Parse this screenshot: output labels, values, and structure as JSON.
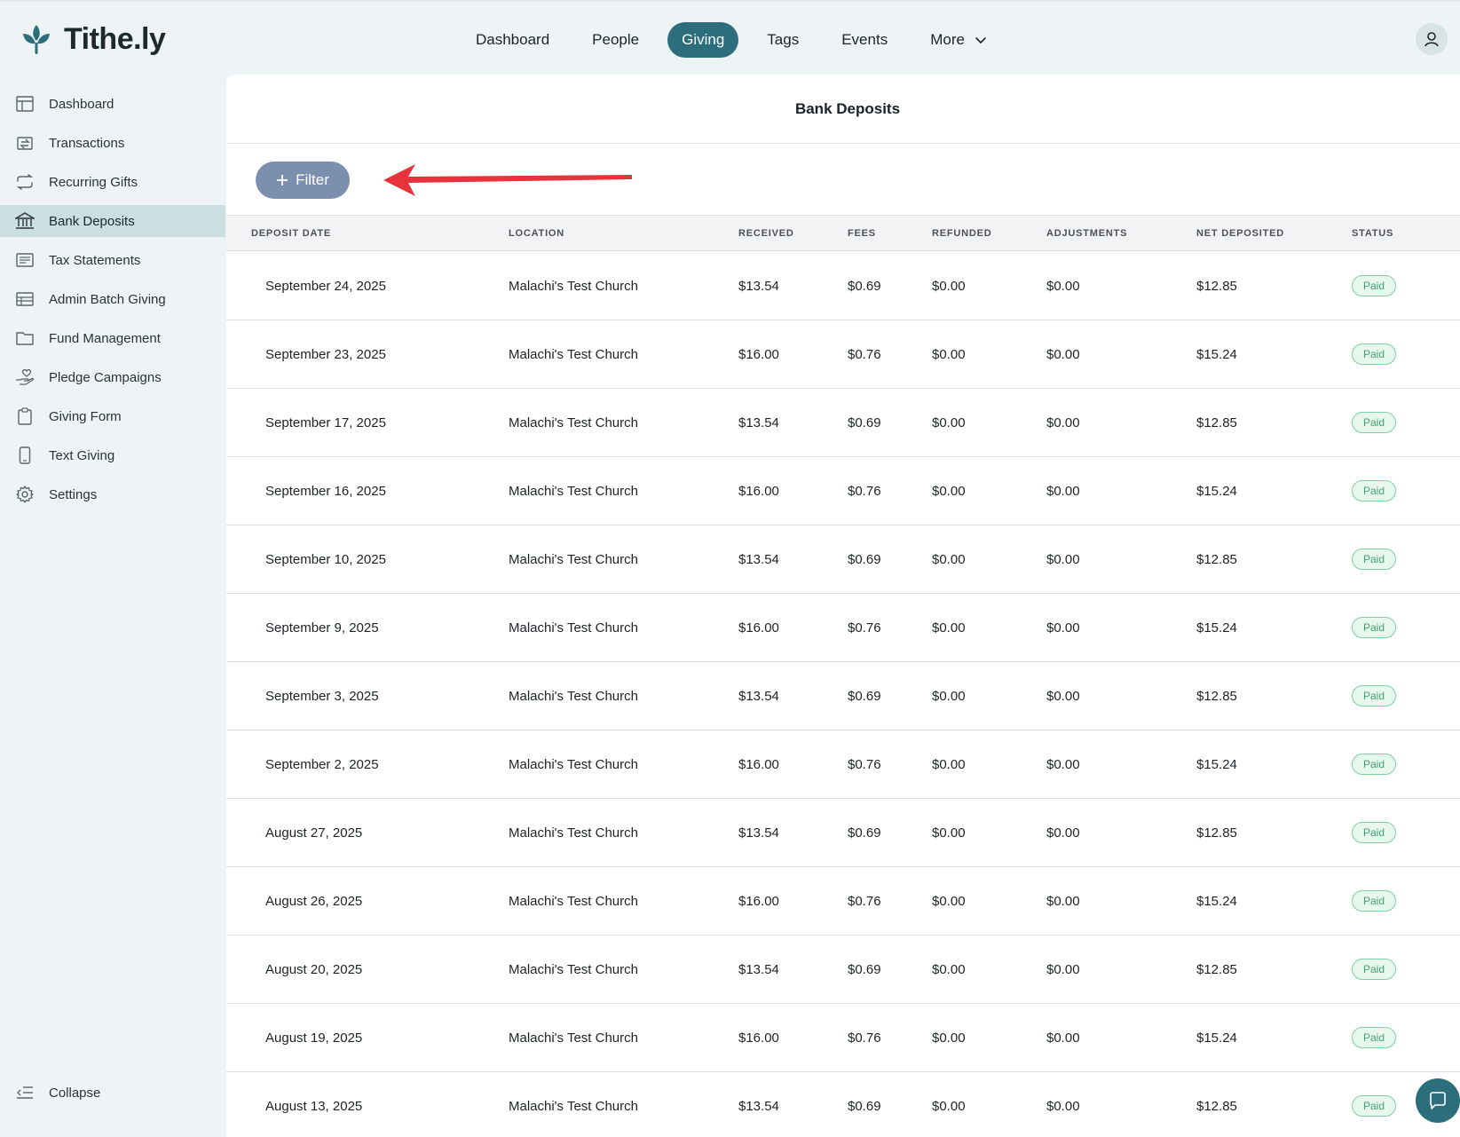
{
  "brand": {
    "name": "Tithe.ly",
    "color": "#2d6e7c"
  },
  "topnav": [
    {
      "label": "Dashboard",
      "active": false
    },
    {
      "label": "People",
      "active": false
    },
    {
      "label": "Giving",
      "active": true
    },
    {
      "label": "Tags",
      "active": false
    },
    {
      "label": "Events",
      "active": false
    },
    {
      "label": "More",
      "active": false,
      "has_dropdown": true
    }
  ],
  "sidebar": {
    "items": [
      {
        "label": "Dashboard",
        "icon": "layout-icon",
        "active": false
      },
      {
        "label": "Transactions",
        "icon": "transfer-icon",
        "active": false
      },
      {
        "label": "Recurring Gifts",
        "icon": "repeat-icon",
        "active": false
      },
      {
        "label": "Bank Deposits",
        "icon": "bank-icon",
        "active": true
      },
      {
        "label": "Tax Statements",
        "icon": "statement-icon",
        "active": false
      },
      {
        "label": "Admin Batch Giving",
        "icon": "table-icon",
        "active": false
      },
      {
        "label": "Fund Management",
        "icon": "folder-icon",
        "active": false
      },
      {
        "label": "Pledge Campaigns",
        "icon": "hand-heart-icon",
        "active": false
      },
      {
        "label": "Giving Form",
        "icon": "clipboard-icon",
        "active": false
      },
      {
        "label": "Text Giving",
        "icon": "phone-icon",
        "active": false
      },
      {
        "label": "Settings",
        "icon": "gear-icon",
        "active": false
      }
    ],
    "collapse_label": "Collapse"
  },
  "page": {
    "title": "Bank Deposits",
    "filter_label": "Filter"
  },
  "table": {
    "columns": [
      "DEPOSIT DATE",
      "LOCATION",
      "RECEIVED",
      "FEES",
      "REFUNDED",
      "ADJUSTMENTS",
      "NET DEPOSITED",
      "STATUS"
    ],
    "rows": [
      {
        "date": "September 24, 2025",
        "location": "Malachi's Test Church",
        "received": "$13.54",
        "fees": "$0.69",
        "refunded": "$0.00",
        "adjustments": "$0.00",
        "net": "$12.85",
        "status": "Paid"
      },
      {
        "date": "September 23, 2025",
        "location": "Malachi's Test Church",
        "received": "$16.00",
        "fees": "$0.76",
        "refunded": "$0.00",
        "adjustments": "$0.00",
        "net": "$15.24",
        "status": "Paid"
      },
      {
        "date": "September 17, 2025",
        "location": "Malachi's Test Church",
        "received": "$13.54",
        "fees": "$0.69",
        "refunded": "$0.00",
        "adjustments": "$0.00",
        "net": "$12.85",
        "status": "Paid"
      },
      {
        "date": "September 16, 2025",
        "location": "Malachi's Test Church",
        "received": "$16.00",
        "fees": "$0.76",
        "refunded": "$0.00",
        "adjustments": "$0.00",
        "net": "$15.24",
        "status": "Paid"
      },
      {
        "date": "September 10, 2025",
        "location": "Malachi's Test Church",
        "received": "$13.54",
        "fees": "$0.69",
        "refunded": "$0.00",
        "adjustments": "$0.00",
        "net": "$12.85",
        "status": "Paid"
      },
      {
        "date": "September 9, 2025",
        "location": "Malachi's Test Church",
        "received": "$16.00",
        "fees": "$0.76",
        "refunded": "$0.00",
        "adjustments": "$0.00",
        "net": "$15.24",
        "status": "Paid"
      },
      {
        "date": "September 3, 2025",
        "location": "Malachi's Test Church",
        "received": "$13.54",
        "fees": "$0.69",
        "refunded": "$0.00",
        "adjustments": "$0.00",
        "net": "$12.85",
        "status": "Paid"
      },
      {
        "date": "September 2, 2025",
        "location": "Malachi's Test Church",
        "received": "$16.00",
        "fees": "$0.76",
        "refunded": "$0.00",
        "adjustments": "$0.00",
        "net": "$15.24",
        "status": "Paid"
      },
      {
        "date": "August 27, 2025",
        "location": "Malachi's Test Church",
        "received": "$13.54",
        "fees": "$0.69",
        "refunded": "$0.00",
        "adjustments": "$0.00",
        "net": "$12.85",
        "status": "Paid"
      },
      {
        "date": "August 26, 2025",
        "location": "Malachi's Test Church",
        "received": "$16.00",
        "fees": "$0.76",
        "refunded": "$0.00",
        "adjustments": "$0.00",
        "net": "$15.24",
        "status": "Paid"
      },
      {
        "date": "August 20, 2025",
        "location": "Malachi's Test Church",
        "received": "$13.54",
        "fees": "$0.69",
        "refunded": "$0.00",
        "adjustments": "$0.00",
        "net": "$12.85",
        "status": "Paid"
      },
      {
        "date": "August 19, 2025",
        "location": "Malachi's Test Church",
        "received": "$16.00",
        "fees": "$0.76",
        "refunded": "$0.00",
        "adjustments": "$0.00",
        "net": "$15.24",
        "status": "Paid"
      },
      {
        "date": "August 13, 2025",
        "location": "Malachi's Test Church",
        "received": "$13.54",
        "fees": "$0.69",
        "refunded": "$0.00",
        "adjustments": "$0.00",
        "net": "$12.85",
        "status": "Paid"
      }
    ]
  },
  "colors": {
    "annotation_arrow": "#e8323c",
    "status_paid": "#3fa56f"
  }
}
